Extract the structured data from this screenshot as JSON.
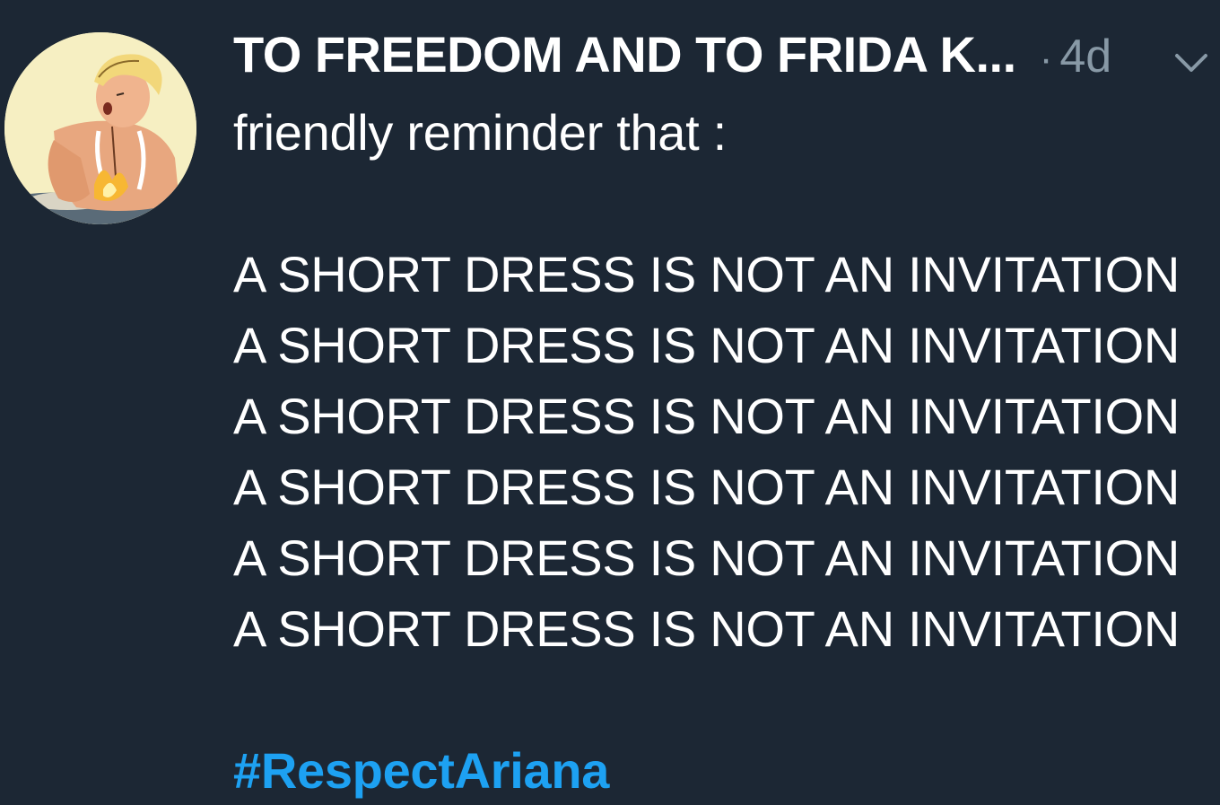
{
  "tweet": {
    "display_name": "TO FREEDOM AND TO FRIDA K...",
    "separator": "·",
    "timestamp": "4d",
    "intro": "friendly reminder that :",
    "repeated_lines": [
      "A SHORT DRESS IS NOT AN INVITATION",
      "A SHORT DRESS IS NOT AN INVITATION",
      "A SHORT DRESS IS NOT AN INVITATION",
      "A SHORT DRESS IS NOT AN INVITATION",
      "A SHORT DRESS IS NOT AN INVITATION",
      "A SHORT DRESS IS NOT AN INVITATION"
    ],
    "hashtag": "#RespectAriana"
  },
  "icons": {
    "menu": "chevron-down-icon",
    "avatar": "avatar-illustration"
  },
  "colors": {
    "background": "#1c2734",
    "text": "#ffffff",
    "muted": "#8899a6",
    "link": "#1da1f2"
  }
}
